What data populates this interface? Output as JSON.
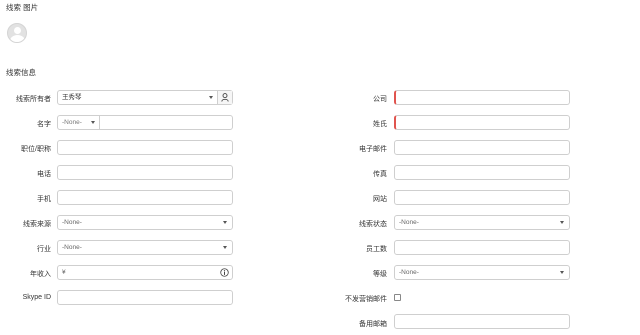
{
  "photo_section": {
    "title": "线索 图片"
  },
  "info_section": {
    "title": "线索信息"
  },
  "left_fields": {
    "owner": {
      "label": "线索所有者",
      "value": "王秀琴"
    },
    "name": {
      "label": "名字",
      "salutation": "-None-"
    },
    "title": {
      "label": "职位/职称"
    },
    "phone": {
      "label": "电话"
    },
    "mobile": {
      "label": "手机"
    },
    "source": {
      "label": "线索来源",
      "value": "-None-"
    },
    "industry": {
      "label": "行业",
      "value": "-None-"
    },
    "revenue": {
      "label": "年收入",
      "currency": "¥"
    },
    "skype": {
      "label": "Skype ID"
    }
  },
  "right_fields": {
    "company": {
      "label": "公司"
    },
    "lastname": {
      "label": "姓氏"
    },
    "email": {
      "label": "电子邮件"
    },
    "fax": {
      "label": "传真"
    },
    "website": {
      "label": "网站"
    },
    "status": {
      "label": "线索状态",
      "value": "-None-"
    },
    "employees": {
      "label": "员工数"
    },
    "rating": {
      "label": "等级",
      "value": "-None-"
    },
    "email_optout": {
      "label": "不发营销邮件",
      "checked": false
    },
    "secondary_email": {
      "label": "备用邮箱"
    }
  },
  "colors": {
    "mandatory": "#e0544e",
    "border": "#cfcfcf"
  },
  "icons": {
    "owner_lookup": "user-icon",
    "revenue_info": "info-icon",
    "avatar": "avatar-placeholder-icon"
  }
}
